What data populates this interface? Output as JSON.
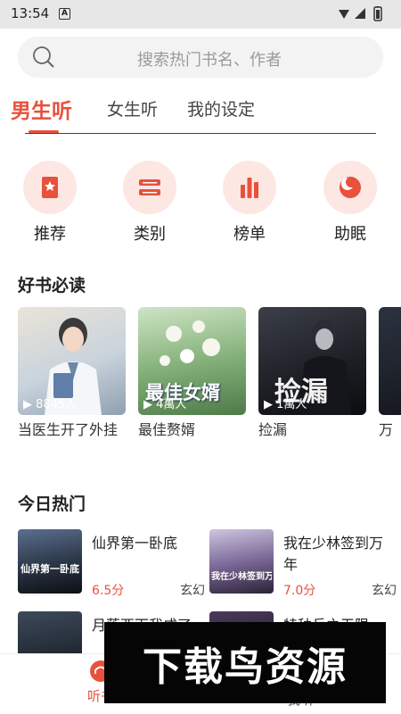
{
  "status_bar": {
    "time": "13:54",
    "app_icon": "A"
  },
  "search": {
    "placeholder": "搜索热门书名、作者"
  },
  "tabs": [
    {
      "label": "男生听",
      "active": true
    },
    {
      "label": "女生听",
      "active": false
    },
    {
      "label": "我的设定",
      "active": false
    }
  ],
  "categories": [
    {
      "label": "推荐",
      "icon": "bookmark-icon"
    },
    {
      "label": "类别",
      "icon": "category-icon"
    },
    {
      "label": "榜单",
      "icon": "chart-icon"
    },
    {
      "label": "助眠",
      "icon": "moon-icon"
    }
  ],
  "good_books": {
    "title": "好书必读",
    "items": [
      {
        "title": "当医生开了外挂",
        "plays": "8845人",
        "cover_text": ""
      },
      {
        "title": "最佳赘婿",
        "plays": "4萬人",
        "cover_text": "最佳女婿"
      },
      {
        "title": "捡漏",
        "plays": "1萬人",
        "cover_text": "捡漏"
      },
      {
        "title": "万",
        "plays": "",
        "cover_text": ""
      }
    ]
  },
  "today_hot": {
    "title": "今日热门",
    "items": [
      {
        "title": "仙界第一卧底",
        "score": "6.5分",
        "genre": "玄幻",
        "cover_text": "仙界第一卧底"
      },
      {
        "title": "我在少林签到万年",
        "score": "7.0分",
        "genre": "玄幻",
        "cover_text": "我在少林签到万年"
      },
      {
        "title": "月落西下我成了",
        "score": "",
        "genre": "",
        "cover_text": ""
      },
      {
        "title": "特种兵之无限",
        "score": "",
        "genre": "",
        "cover_text": ""
      }
    ]
  },
  "bottom_nav": {
    "listen": "听书",
    "mine": "我听"
  },
  "watermark": {
    "text": "下载鸟资源"
  },
  "colors": {
    "accent": "#e8513c",
    "accent_light": "#fde7e3"
  }
}
